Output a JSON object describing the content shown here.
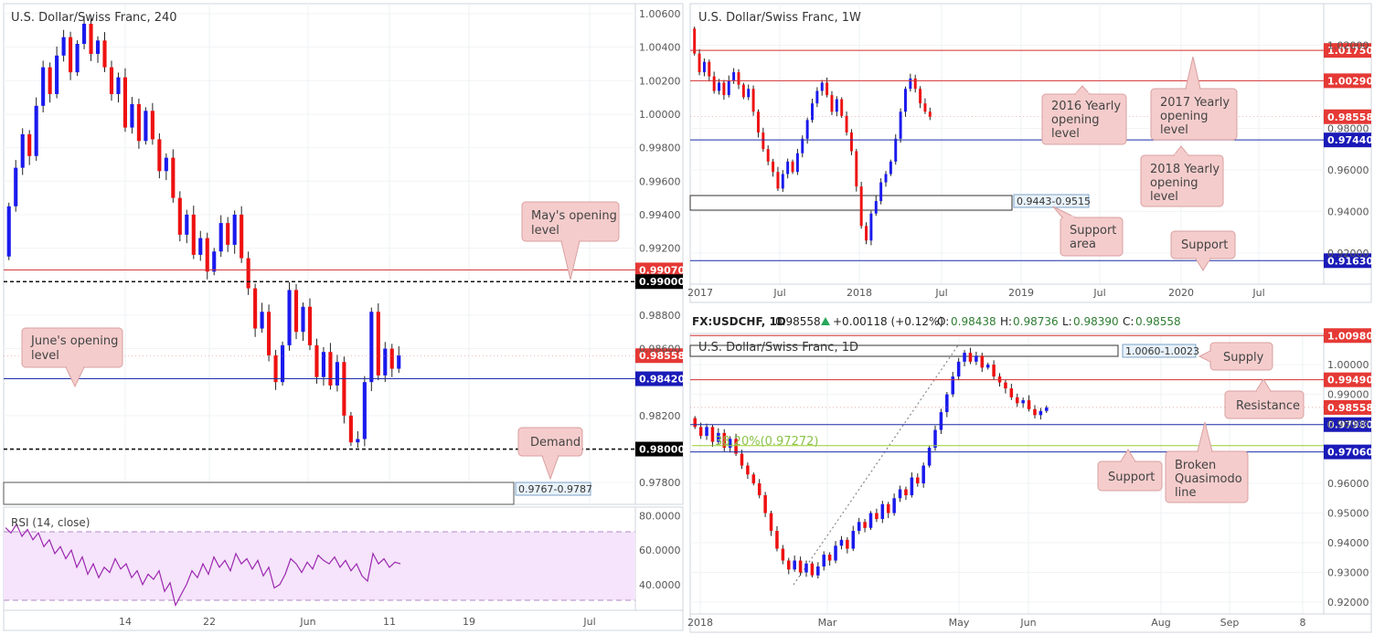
{
  "colors": {
    "bull": "#1a1aee",
    "bear": "#ee1111",
    "red_line": "#d32f2f",
    "blue_line": "#1c2fa8",
    "tag_red": "#e53935",
    "tag_blue": "#1a1ab8",
    "tag_black": "#000000",
    "callout_bg": "#f5cccc",
    "callout_border": "#d9a0a0",
    "rsi_fill": "#f5e4fb",
    "rsi_line": "#9c27b0",
    "fib": "#9acd32",
    "zone_label_bg": "#e8f2fa"
  },
  "chart_data": [
    {
      "id": "h4",
      "type": "candlestick",
      "title": "U.S. Dollar/Swiss Franc, 240",
      "ylim": [
        0.9767,
        1.0066
      ],
      "y_ticks": [
        "1.00600",
        "1.00400",
        "1.00200",
        "1.00000",
        "0.99800",
        "0.99600",
        "0.99400",
        "0.99200",
        "0.98800",
        "0.98600",
        "0.98200",
        "0.97800"
      ],
      "x_ticks": [
        "14",
        "22",
        "Jun",
        "11",
        "19",
        "Jul"
      ],
      "series": [
        {
          "points": [
            [
              0.9915,
              0.9945
            ],
            [
              0.9945,
              0.9968
            ],
            [
              0.9968,
              0.9988
            ],
            [
              0.9988,
              0.9975
            ],
            [
              0.9975,
              1.0005
            ],
            [
              1.0005,
              1.0028
            ],
            [
              1.0028,
              1.0012
            ],
            [
              1.0012,
              1.0035
            ],
            [
              1.0035,
              1.0046
            ],
            [
              1.0046,
              1.0025
            ],
            [
              1.0025,
              1.0042
            ],
            [
              1.0042,
              1.0054
            ],
            [
              1.0054,
              1.0036
            ],
            [
              1.0036,
              1.0044
            ],
            [
              1.0044,
              1.0028
            ],
            [
              1.0028,
              1.0012
            ],
            [
              1.0012,
              1.0022
            ],
            [
              1.0022,
              0.9992
            ],
            [
              0.9992,
              1.0006
            ],
            [
              1.0006,
              0.9984
            ],
            [
              0.9984,
              1.0002
            ],
            [
              1.0002,
              0.9985
            ],
            [
              0.9985,
              0.9966
            ],
            [
              0.9966,
              0.9974
            ],
            [
              0.9974,
              0.995
            ],
            [
              0.995,
              0.9928
            ],
            [
              0.9928,
              0.994
            ],
            [
              0.994,
              0.9916
            ],
            [
              0.9916,
              0.9926
            ],
            [
              0.9926,
              0.9906
            ],
            [
              0.9906,
              0.9918
            ],
            [
              0.9918,
              0.9935
            ],
            [
              0.9935,
              0.9922
            ],
            [
              0.9922,
              0.994
            ],
            [
              0.994,
              0.9914
            ],
            [
              0.9914,
              0.9896
            ],
            [
              0.9896,
              0.9872
            ],
            [
              0.9872,
              0.9882
            ],
            [
              0.9882,
              0.9856
            ],
            [
              0.9856,
              0.984
            ],
            [
              0.984,
              0.9862
            ],
            [
              0.9862,
              0.9895
            ],
            [
              0.9895,
              0.987
            ],
            [
              0.987,
              0.9885
            ],
            [
              0.9885,
              0.9862
            ],
            [
              0.9862,
              0.9843
            ],
            [
              0.9843,
              0.9858
            ],
            [
              0.9858,
              0.9838
            ],
            [
              0.9838,
              0.9852
            ],
            [
              0.9852,
              0.982
            ],
            [
              0.982,
              0.9804
            ],
            [
              0.9804,
              0.9806
            ],
            [
              0.9806,
              0.984
            ],
            [
              0.984,
              0.9882
            ],
            [
              0.9882,
              0.9844
            ],
            [
              0.9844,
              0.986
            ],
            [
              0.986,
              0.9848
            ],
            [
              0.9848,
              0.9856
            ]
          ]
        }
      ],
      "levels": [
        {
          "id": "mays-opening",
          "value": 0.9907,
          "tag": "0.99070",
          "style": "red"
        },
        {
          "id": "figure-0-99",
          "value": 0.99,
          "tag": "0.99000",
          "style": "dashed"
        },
        {
          "id": "current",
          "value": 0.98558,
          "tag": "0.98558",
          "style": "current"
        },
        {
          "id": "junes-opening",
          "value": 0.9842,
          "tag": "0.98420",
          "style": "blue"
        },
        {
          "id": "figure-0-98",
          "value": 0.98,
          "tag": "0.98000",
          "style": "dashed"
        }
      ],
      "zones": [
        {
          "id": "demand",
          "from": 0.9767,
          "to": 0.9787,
          "label": "0.9767-0.9787"
        }
      ],
      "callouts": [
        "May's opening level",
        "June's opening level",
        "Demand"
      ]
    },
    {
      "id": "rsi",
      "type": "line",
      "title": "RSI (14, close)",
      "ylim": [
        25,
        85
      ],
      "y_ticks": [
        "80.0000",
        "60.0000",
        "40.0000"
      ],
      "bands": [
        30,
        70
      ],
      "series": [
        {
          "name": "RSI (14, close)",
          "values": [
            73,
            70,
            75,
            68,
            72,
            66,
            70,
            62,
            66,
            58,
            62,
            55,
            60,
            50,
            56,
            46,
            52,
            44,
            50,
            47,
            55,
            49,
            52,
            44,
            48,
            40,
            46,
            43,
            48,
            36,
            41,
            28,
            34,
            40,
            48,
            44,
            52,
            46,
            56,
            50,
            54,
            48,
            58,
            52,
            55,
            49,
            54,
            45,
            50,
            38,
            40,
            46,
            55,
            52,
            47,
            53,
            49,
            57,
            54,
            52,
            56,
            50,
            54,
            48,
            52,
            45,
            42,
            58,
            52,
            55,
            50,
            53,
            52
          ]
        }
      ]
    },
    {
      "id": "weekly",
      "type": "candlestick",
      "title": "U.S. Dollar/Swiss Franc, 1W",
      "ylim": [
        0.905,
        1.04
      ],
      "y_ticks": [
        "1.04000",
        "1.02000",
        "0.98000",
        "0.96000",
        "0.94000",
        "0.92000"
      ],
      "x_ticks": [
        "2017",
        "Jul",
        "2018",
        "Jul",
        "2019",
        "Jul",
        "2020",
        "Jul"
      ],
      "series": [
        {
          "points": [
            [
              1.028,
              1.016
            ],
            [
              1.016,
              1.007
            ],
            [
              1.007,
              1.012
            ],
            [
              1.012,
              1.005
            ],
            [
              1.005,
              0.998
            ],
            [
              0.998,
              1.002
            ],
            [
              1.002,
              0.996
            ],
            [
              0.996,
              1.003
            ],
            [
              1.003,
              1.007
            ],
            [
              1.007,
              1.001
            ],
            [
              1.001,
              0.995
            ],
            [
              0.995,
              0.999
            ],
            [
              0.999,
              0.988
            ],
            [
              0.988,
              0.978
            ],
            [
              0.978,
              0.97
            ],
            [
              0.97,
              0.964
            ],
            [
              0.964,
              0.959
            ],
            [
              0.959,
              0.951
            ],
            [
              0.951,
              0.958
            ],
            [
              0.958,
              0.964
            ],
            [
              0.964,
              0.959
            ],
            [
              0.959,
              0.968
            ],
            [
              0.968,
              0.975
            ],
            [
              0.975,
              0.984
            ],
            [
              0.984,
              0.992
            ],
            [
              0.992,
              0.998
            ],
            [
              0.998,
              1.002
            ],
            [
              1.002,
              0.996
            ],
            [
              0.996,
              0.988
            ],
            [
              0.988,
              0.994
            ],
            [
              0.994,
              0.986
            ],
            [
              0.986,
              0.978
            ],
            [
              0.978,
              0.969
            ],
            [
              0.969,
              0.952
            ],
            [
              0.952,
              0.933
            ],
            [
              0.933,
              0.926
            ],
            [
              0.926,
              0.939
            ],
            [
              0.939,
              0.945
            ],
            [
              0.945,
              0.954
            ],
            [
              0.954,
              0.958
            ],
            [
              0.958,
              0.964
            ],
            [
              0.964,
              0.975
            ],
            [
              0.975,
              0.988
            ],
            [
              0.988,
              0.999
            ],
            [
              0.999,
              1.004
            ],
            [
              1.004,
              0.999
            ],
            [
              0.999,
              0.992
            ],
            [
              0.992,
              0.988
            ],
            [
              0.988,
              0.9856
            ]
          ]
        }
      ],
      "levels": [
        {
          "id": "2017-yearly",
          "value": 1.0175,
          "tag": "1.01750",
          "style": "red"
        },
        {
          "id": "2016-yearly",
          "value": 1.0029,
          "tag": "1.00290",
          "style": "red"
        },
        {
          "id": "current",
          "value": 0.98558,
          "tag": "0.98558",
          "style": "current"
        },
        {
          "id": "2018-yearly",
          "value": 0.9744,
          "tag": "0.97440",
          "style": "blue"
        },
        {
          "id": "support",
          "value": 0.9163,
          "tag": "0.91630",
          "style": "blue"
        }
      ],
      "zones": [
        {
          "id": "support-area",
          "from": 0.9443,
          "to": 0.9515,
          "label": "0.9443-0.9515"
        }
      ],
      "callouts": [
        "2016 Yearly opening level",
        "2017 Yearly opening level",
        "2018 Yearly opening level",
        "Support area",
        "Support"
      ]
    },
    {
      "id": "daily",
      "type": "candlestick",
      "title": "U.S. Dollar/Swiss Franc, 1D",
      "ylim": [
        0.916,
        1.0105
      ],
      "y_ticks": [
        "1.00000",
        "0.99000",
        "0.98000",
        "0.96000",
        "0.95000",
        "0.94000",
        "0.93000",
        "0.92000"
      ],
      "x_ticks": [
        "2018",
        "Mar",
        "May",
        "Jun",
        "Aug",
        "Sep",
        "8"
      ],
      "series": [
        {
          "points": [
            [
              0.982,
              0.979
            ],
            [
              0.979,
              0.976
            ],
            [
              0.976,
              0.979
            ],
            [
              0.979,
              0.974
            ],
            [
              0.974,
              0.977
            ],
            [
              0.977,
              0.972
            ],
            [
              0.972,
              0.975
            ],
            [
              0.975,
              0.97
            ],
            [
              0.97,
              0.966
            ],
            [
              0.966,
              0.963
            ],
            [
              0.963,
              0.96
            ],
            [
              0.96,
              0.956
            ],
            [
              0.956,
              0.95
            ],
            [
              0.95,
              0.944
            ],
            [
              0.944,
              0.938
            ],
            [
              0.938,
              0.934
            ],
            [
              0.934,
              0.931
            ],
            [
              0.931,
              0.934
            ],
            [
              0.934,
              0.93
            ],
            [
              0.93,
              0.933
            ],
            [
              0.933,
              0.929
            ],
            [
              0.929,
              0.932
            ],
            [
              0.932,
              0.936
            ],
            [
              0.936,
              0.934
            ],
            [
              0.934,
              0.939
            ],
            [
              0.939,
              0.941
            ],
            [
              0.941,
              0.938
            ],
            [
              0.938,
              0.944
            ],
            [
              0.944,
              0.947
            ],
            [
              0.947,
              0.945
            ],
            [
              0.945,
              0.95
            ],
            [
              0.95,
              0.948
            ],
            [
              0.948,
              0.953
            ],
            [
              0.953,
              0.95
            ],
            [
              0.95,
              0.955
            ],
            [
              0.955,
              0.958
            ],
            [
              0.958,
              0.956
            ],
            [
              0.956,
              0.962
            ],
            [
              0.962,
              0.96
            ],
            [
              0.96,
              0.966
            ],
            [
              0.966,
              0.972
            ],
            [
              0.972,
              0.978
            ],
            [
              0.978,
              0.984
            ],
            [
              0.984,
              0.99
            ],
            [
              0.99,
              0.996
            ],
            [
              0.996,
              1.001
            ],
            [
              1.001,
              1.004
            ],
            [
              1.004,
              1.001
            ],
            [
              1.001,
              1.003
            ],
            [
              1.003,
              0.999
            ],
            [
              0.999,
              1.0
            ],
            [
              1.0,
              0.996
            ],
            [
              0.996,
              0.994
            ],
            [
              0.994,
              0.992
            ],
            [
              0.992,
              0.989
            ],
            [
              0.989,
              0.987
            ],
            [
              0.987,
              0.988
            ],
            [
              0.988,
              0.985
            ],
            [
              0.985,
              0.983
            ],
            [
              0.983,
              0.9844
            ],
            [
              0.9844,
              0.9856
            ]
          ]
        }
      ],
      "levels": [
        {
          "id": "top",
          "value": 1.0098,
          "tag": "1.00980",
          "style": "red"
        },
        {
          "id": "resistance",
          "value": 0.9949,
          "tag": "0.99490",
          "style": "red"
        },
        {
          "id": "current",
          "value": 0.98558,
          "tag": "0.98558",
          "style": "current"
        },
        {
          "id": "support",
          "value": 0.9798,
          "tag": "0.97980",
          "style": "blue"
        },
        {
          "id": "broken-qm",
          "value": 0.9706,
          "tag": "0.97060",
          "style": "blue"
        }
      ],
      "fib": {
        "value": 0.97272,
        "label": "38.20%(0.97272)"
      },
      "zones": [
        {
          "id": "supply",
          "from": 1.0023,
          "to": 1.006,
          "label": "1.0060-1.0023"
        }
      ],
      "callouts": [
        "Supply",
        "Resistance",
        "Support",
        "Broken Quasimodo line"
      ]
    }
  ],
  "daily_info": {
    "symbol": "FX:USDCHF, 1D",
    "price": "0.98558",
    "change": "+0.00118 (+0.12%)",
    "o_label": "O:",
    "o": "0.98438",
    "h_label": "H:",
    "h": "0.98736",
    "l_label": "L:",
    "l": "0.98390",
    "c_label": "C:",
    "c": "0.98558"
  }
}
